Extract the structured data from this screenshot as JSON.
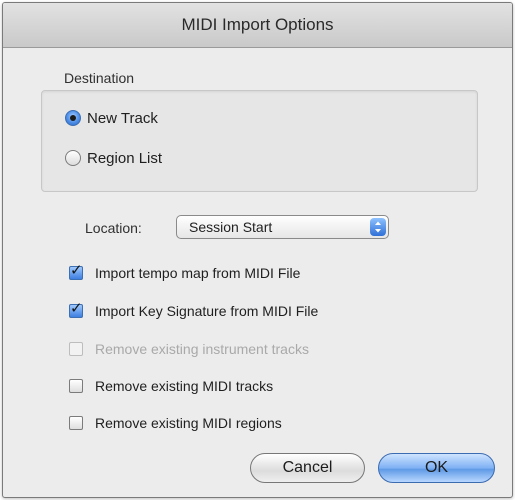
{
  "window": {
    "title": "MIDI Import Options"
  },
  "destination": {
    "label": "Destination",
    "options": [
      {
        "label": "New Track",
        "selected": true
      },
      {
        "label": "Region List",
        "selected": false
      }
    ]
  },
  "location": {
    "label": "Location:",
    "selected": "Session Start"
  },
  "checkboxes": [
    {
      "label": "Import tempo map from MIDI File",
      "checked": true,
      "enabled": true
    },
    {
      "label": "Import Key Signature from MIDI File",
      "checked": true,
      "enabled": true
    },
    {
      "label": "Remove existing instrument tracks",
      "checked": false,
      "enabled": false
    },
    {
      "label": "Remove existing MIDI tracks",
      "checked": false,
      "enabled": true
    },
    {
      "label": "Remove existing MIDI regions",
      "checked": false,
      "enabled": true
    }
  ],
  "buttons": {
    "cancel": "Cancel",
    "ok": "OK"
  },
  "colors": {
    "accent": "#4c8ee8",
    "disabled_text": "#a9a9a9"
  }
}
